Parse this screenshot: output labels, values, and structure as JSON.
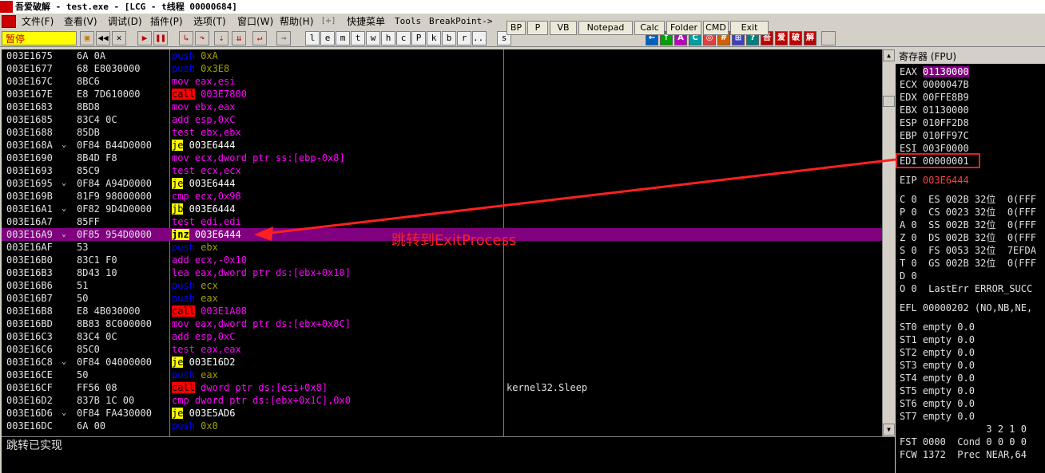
{
  "window": {
    "title": "吾爱破解 - test.exe - [LCG - t线程  00000684]",
    "icon_text": "吾爱破解"
  },
  "menu": [
    "文件(F)",
    "查看(V)",
    "调试(D)",
    "插件(P)",
    "选项(T)",
    "窗口(W)",
    "帮助(H)",
    "[+]",
    "快捷菜单",
    "Tools",
    "BreakPoint->"
  ],
  "top_buttons": [
    "BP",
    "P",
    "VB",
    "Notepad",
    "Calc",
    "Folder",
    "CMD",
    "Exit"
  ],
  "toolbar": {
    "status": "暂停",
    "nav_icons": [
      "open-icon",
      "rewind-icon",
      "close-icon",
      "run-icon",
      "pause-icon",
      "step-into-icon",
      "step-over-icon",
      "trace-into-icon",
      "trace-over-icon",
      "execute-till-return-icon",
      "goto-icon"
    ],
    "letters": [
      "l",
      "e",
      "m",
      "t",
      "w",
      "h",
      "c",
      "P",
      "k",
      "b",
      "r",
      "...",
      "s"
    ],
    "right_icons": [
      "←",
      "↑",
      "A",
      "C",
      "◎",
      "#",
      "⊞",
      "?",
      "吾",
      "爱",
      "破",
      "解"
    ]
  },
  "disasm": {
    "rows": [
      {
        "addr": "003E1675",
        "mark": "",
        "hex": "6A 0A",
        "mn": "push",
        "op": " 0xA",
        "cls": "push",
        "cmt": ""
      },
      {
        "addr": "003E1677",
        "mark": "",
        "hex": "68 E8030000",
        "mn": "push",
        "op": " 0x3E8",
        "cls": "push",
        "cmt": ""
      },
      {
        "addr": "003E167C",
        "mark": "",
        "hex": "8BC6",
        "mn": "mov",
        "op": " eax,esi",
        "cls": "mov",
        "cmt": ""
      },
      {
        "addr": "003E167E",
        "mark": "",
        "hex": "E8 7D610000",
        "mn": "call",
        "op": " 003E7800",
        "cls": "call",
        "cmt": ""
      },
      {
        "addr": "003E1683",
        "mark": "",
        "hex": "8BD8",
        "mn": "mov",
        "op": " ebx,eax",
        "cls": "mov",
        "cmt": ""
      },
      {
        "addr": "003E1685",
        "mark": "",
        "hex": "83C4 0C",
        "mn": "add",
        "op": " esp,0xC",
        "cls": "add",
        "cmt": ""
      },
      {
        "addr": "003E1688",
        "mark": "",
        "hex": "85DB",
        "mn": "test",
        "op": " ebx,ebx",
        "cls": "test",
        "cmt": ""
      },
      {
        "addr": "003E168A",
        "mark": "⌄",
        "hex": "0F84 B44D0000",
        "mn": "je",
        "op": " 003E6444",
        "cls": "jump",
        "cmt": ""
      },
      {
        "addr": "003E1690",
        "mark": "",
        "hex": "8B4D F8",
        "mn": "mov",
        "op": " ecx,dword ptr ss:[ebp-0x8]",
        "cls": "mov",
        "cmt": ""
      },
      {
        "addr": "003E1693",
        "mark": "",
        "hex": "85C9",
        "mn": "test",
        "op": " ecx,ecx",
        "cls": "test",
        "cmt": ""
      },
      {
        "addr": "003E1695",
        "mark": "⌄",
        "hex": "0F84 A94D0000",
        "mn": "je",
        "op": " 003E6444",
        "cls": "jump",
        "cmt": ""
      },
      {
        "addr": "003E169B",
        "mark": "",
        "hex": "81F9 98000000",
        "mn": "cmp",
        "op": " ecx,0x98",
        "cls": "cmp",
        "cmt": ""
      },
      {
        "addr": "003E16A1",
        "mark": "⌄",
        "hex": "0F82 9D4D0000",
        "mn": "jb",
        "op": " 003E6444",
        "cls": "jump",
        "cmt": ""
      },
      {
        "addr": "003E16A7",
        "mark": "",
        "hex": "85FF",
        "mn": "test",
        "op": " edi,edi",
        "cls": "test",
        "cmt": ""
      },
      {
        "addr": "003E16A9",
        "mark": "⌄",
        "hex": "0F85 954D0000",
        "mn": "jnz",
        "op": " 003E6444",
        "cls": "jumpsel",
        "cmt": "",
        "sel": true
      },
      {
        "addr": "003E16AF",
        "mark": "",
        "hex": "53",
        "mn": "push",
        "op": " ebx",
        "cls": "push",
        "cmt": ""
      },
      {
        "addr": "003E16B0",
        "mark": "",
        "hex": "83C1 F0",
        "mn": "add",
        "op": " ecx,-0x10",
        "cls": "add",
        "cmt": ""
      },
      {
        "addr": "003E16B3",
        "mark": "",
        "hex": "8D43 10",
        "mn": "lea",
        "op": " eax,dword ptr ds:[ebx+0x10]",
        "cls": "lea",
        "cmt": ""
      },
      {
        "addr": "003E16B6",
        "mark": "",
        "hex": "51",
        "mn": "push",
        "op": " ecx",
        "cls": "push",
        "cmt": ""
      },
      {
        "addr": "003E16B7",
        "mark": "",
        "hex": "50",
        "mn": "push",
        "op": " eax",
        "cls": "push",
        "cmt": ""
      },
      {
        "addr": "003E16B8",
        "mark": "",
        "hex": "E8 4B030000",
        "mn": "call",
        "op": " 003E1A08",
        "cls": "call",
        "cmt": ""
      },
      {
        "addr": "003E16BD",
        "mark": "",
        "hex": "8B83 8C000000",
        "mn": "mov",
        "op": " eax,dword ptr ds:[ebx+0x8C]",
        "cls": "mov",
        "cmt": ""
      },
      {
        "addr": "003E16C3",
        "mark": "",
        "hex": "83C4 0C",
        "mn": "add",
        "op": " esp,0xC",
        "cls": "add",
        "cmt": ""
      },
      {
        "addr": "003E16C6",
        "mark": "",
        "hex": "85C0",
        "mn": "test",
        "op": " eax,eax",
        "cls": "test",
        "cmt": ""
      },
      {
        "addr": "003E16C8",
        "mark": "⌄",
        "hex": "0F84 04000000",
        "mn": "je",
        "op": " 003E16D2",
        "cls": "jump",
        "cmt": ""
      },
      {
        "addr": "003E16CE",
        "mark": "",
        "hex": "50",
        "mn": "push",
        "op": " eax",
        "cls": "push",
        "cmt": ""
      },
      {
        "addr": "003E16CF",
        "mark": "",
        "hex": "FF56 08",
        "mn": "call",
        "op": " dword ptr ds:[esi+0x8]",
        "cls": "call",
        "cmt": "kernel32.Sleep"
      },
      {
        "addr": "003E16D2",
        "mark": "",
        "hex": "837B 1C 00",
        "mn": "cmp",
        "op": " dword ptr ds:[ebx+0x1C],0x0",
        "cls": "cmp",
        "cmt": ""
      },
      {
        "addr": "003E16D6",
        "mark": "⌄",
        "hex": "0F84 FA430000",
        "mn": "je",
        "op": " 003E5AD6",
        "cls": "jump",
        "cmt": ""
      },
      {
        "addr": "003E16DC",
        "mark": "",
        "hex": "6A 00",
        "mn": "push",
        "op": " 0x0",
        "cls": "push",
        "cmt": ""
      }
    ]
  },
  "annotation": "跳转到ExitProcess",
  "info_text": "跳转已实现",
  "registers": {
    "header": "寄存器 (FPU)",
    "general": [
      {
        "name": "EAX",
        "value": "01130000",
        "style": "hl"
      },
      {
        "name": "ECX",
        "value": "0000047B",
        "style": ""
      },
      {
        "name": "EDX",
        "value": "00FFE8B9",
        "style": ""
      },
      {
        "name": "EBX",
        "value": "01130000",
        "style": ""
      },
      {
        "name": "ESP",
        "value": "010FF2D8",
        "style": ""
      },
      {
        "name": "EBP",
        "value": "010FF97C",
        "style": ""
      },
      {
        "name": "ESI",
        "value": "003F0000",
        "style": ""
      },
      {
        "name": "EDI",
        "value": "00000001",
        "style": ""
      }
    ],
    "eip": {
      "name": "EIP",
      "value": "003E6444"
    },
    "flags": [
      "C 0  ES 002B 32位  0(FFF",
      "P 0  CS 0023 32位  0(FFF",
      "A 0  SS 002B 32位  0(FFF",
      "Z 0  DS 002B 32位  0(FFF",
      "S 0  FS 0053 32位  7EFDA",
      "T 0  GS 002B 32位  0(FFF",
      "D 0",
      "O 0  LastErr ERROR_SUCC"
    ],
    "efl": "EFL 00000202 (NO,NB,NE,",
    "fpu": [
      "ST0 empty 0.0",
      "ST1 empty 0.0",
      "ST2 empty 0.0",
      "ST3 empty 0.0",
      "ST4 empty 0.0",
      "ST5 empty 0.0",
      "ST6 empty 0.0",
      "ST7 empty 0.0"
    ],
    "fpu_tail": [
      "               3 2 1 0",
      "FST 0000  Cond 0 0 0 0",
      "FCW 1372  Prec NEAR,64"
    ]
  }
}
